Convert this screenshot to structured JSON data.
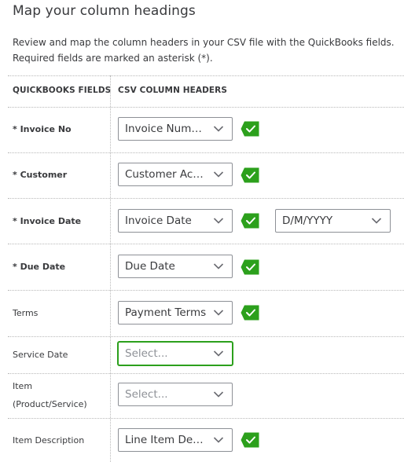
{
  "title": "Map your column headings",
  "description": "Review and map the column headers in your CSV file with the QuickBooks fields. Required fields are marked an asterisk (*).",
  "headers": {
    "qb_fields": "QUICKBOOKS FIELDS",
    "csv_headers": "CSV COLUMN HEADERS"
  },
  "colors": {
    "accent": "#2ca01c",
    "text": "#393a3d",
    "border": "#8d9096"
  },
  "rows": [
    {
      "label": "* Invoice No",
      "value": "Invoice Number",
      "mapped": true
    },
    {
      "label": "* Customer",
      "value": "Customer Ac…",
      "mapped": true
    },
    {
      "label": "* Invoice Date",
      "value": "Invoice Date",
      "mapped": true,
      "format_value": "D/M/YYYY"
    },
    {
      "label": "* Due Date",
      "value": "Due Date",
      "mapped": true
    },
    {
      "label": "Terms",
      "value": "Payment Terms",
      "mapped": true
    },
    {
      "label": "Service Date",
      "placeholder": "Select...",
      "mapped": false,
      "focused": true
    },
    {
      "label_line1": "Item",
      "label_line2": "(Product/Service)",
      "placeholder": "Select...",
      "mapped": false
    },
    {
      "label": "Item Description",
      "value": "Line Item Des…",
      "mapped": true
    }
  ],
  "icons": {
    "dropdown": "chevron-down-icon",
    "mapped": "check-tag-icon"
  }
}
